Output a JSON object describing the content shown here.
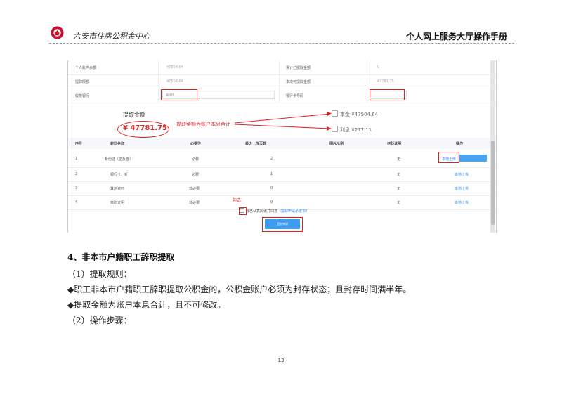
{
  "header": {
    "org_name": "六安市住房公积金中心",
    "manual_title": "个人网上服务大厅操作手册",
    "brand_color": "#c8102e"
  },
  "form": {
    "rows": [
      {
        "label": "个人账户余额",
        "value": "47504.64",
        "label2": "累计已提取金额",
        "value2": "0"
      },
      {
        "label": "提取限额",
        "value": "47504.64",
        "label2": "本次可提取金额",
        "value2": "47781.75"
      },
      {
        "label": "收款银行",
        "value": "请选择",
        "label2": "银行卡号码",
        "value2": ""
      }
    ]
  },
  "amount": {
    "title": "提取金额",
    "value": "¥ 47781.75",
    "note": "提取金额为账户本息合计",
    "principal": "本金 ¥47504.64",
    "interest": "利息 ¥277.11"
  },
  "materials": {
    "headers": [
      "序号",
      "材料名称",
      "必要性",
      "最少上传页数",
      "图片示例",
      "材料说明",
      "操作"
    ],
    "rows": [
      {
        "no": "1",
        "name": "身份证（正反面）",
        "req": "必要",
        "pages": "2",
        "desc": "无",
        "action": "本地上传"
      },
      {
        "no": "2",
        "name": "银行卡、折",
        "req": "必要",
        "pages": "1",
        "desc": "无",
        "action": "本地上传"
      },
      {
        "no": "3",
        "name": "其他资料",
        "req": "非必要",
        "pages": "0",
        "desc": "无",
        "action": "本地上传"
      },
      {
        "no": "4",
        "name": "离职证明",
        "req": "非必要",
        "pages": "0",
        "desc": "无",
        "action": "本地上传"
      }
    ]
  },
  "agreement": {
    "tick_note": "勾选",
    "text": "我已认真阅读并同意",
    "link": "《提取申请承诺书》",
    "submit": "提交申请"
  },
  "body": {
    "heading": "4、非本市户籍职工辞职提取",
    "lines": [
      "（1）提取规则：",
      "◆职工非本市户籍职工辞职提取公积金的，公积金账户必须为封存状态；且封存时间满半年。",
      "◆提取金额为账户本息合计，且不可修改。",
      "（2）操作步骤："
    ]
  },
  "page_number": "13"
}
